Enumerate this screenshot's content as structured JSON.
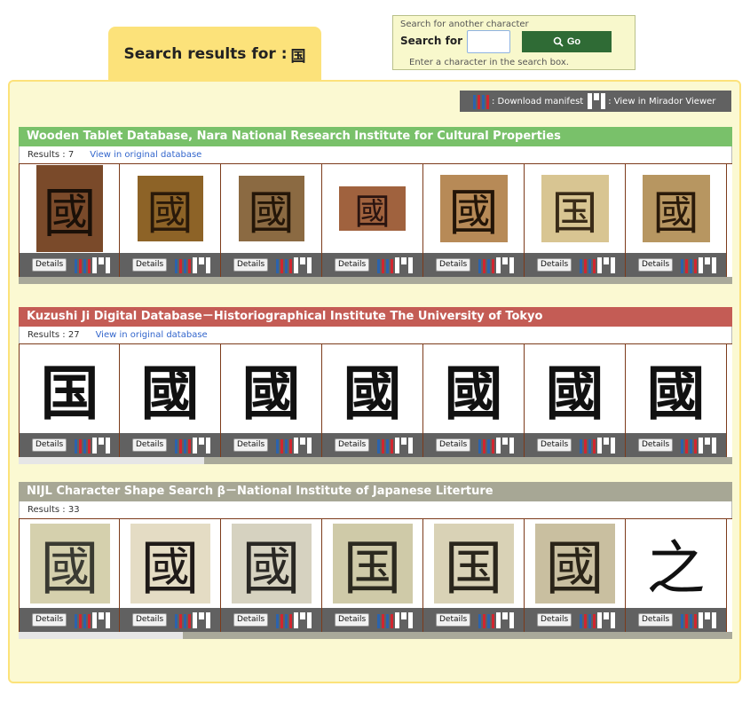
{
  "header": {
    "title_prefix": "Search results for :",
    "query_char": "国"
  },
  "search": {
    "caption": "Search for another character",
    "label": "Search for",
    "value": "",
    "go_label": "Go",
    "hint": "Enter a character in the search box."
  },
  "toolbar": {
    "download_label": ": Download manifest",
    "mirador_label": ": View in Mirador Viewer"
  },
  "icons": {
    "iiif_colors": [
      "#2b63ad",
      "#d1262f",
      "#2b63ad",
      "#d1262f"
    ]
  },
  "sections": [
    {
      "title": "Wooden Tablet Database, Nara National Research Institute for Cultural Properties",
      "header_color": "#79c16a",
      "results_label": "Results : 7",
      "link_label": "View in original database",
      "details_label": "Details",
      "scroll_fraction": 1.0,
      "items": [
        {
          "glyph": "國",
          "bg": "#7a4a2a",
          "fg": "#1a1008"
        },
        {
          "glyph": "國",
          "bg": "#8d6327",
          "fg": "#2a1a0a"
        },
        {
          "glyph": "國",
          "bg": "#8b6a42",
          "fg": "#241608"
        },
        {
          "glyph": "國",
          "bg": "#a0623e",
          "fg": "#2a1410"
        },
        {
          "glyph": "國",
          "bg": "#b78a57",
          "fg": "#231508"
        },
        {
          "glyph": "国",
          "bg": "#d8c592",
          "fg": "#3a2c18"
        },
        {
          "glyph": "國",
          "bg": "#b79661",
          "fg": "#2a1a0a"
        }
      ]
    },
    {
      "title": "Kuzushi Ji Digital Database－Historiographical Institute The University of Tokyo",
      "header_color": "#c45c55",
      "results_label": "Results : 27",
      "link_label": "View in original database",
      "details_label": "Details",
      "scroll_fraction": 0.26,
      "items": [
        {
          "glyph": "国",
          "bg": "#ffffff",
          "fg": "#111111"
        },
        {
          "glyph": "國",
          "bg": "#ffffff",
          "fg": "#111111"
        },
        {
          "glyph": "國",
          "bg": "#ffffff",
          "fg": "#111111"
        },
        {
          "glyph": "國",
          "bg": "#ffffff",
          "fg": "#111111"
        },
        {
          "glyph": "國",
          "bg": "#ffffff",
          "fg": "#111111"
        },
        {
          "glyph": "國",
          "bg": "#ffffff",
          "fg": "#111111"
        },
        {
          "glyph": "國",
          "bg": "#ffffff",
          "fg": "#111111"
        }
      ]
    },
    {
      "title": "NIJL Character Shape Search β－National Institute of Japanese Literture",
      "header_color": "#a7a795",
      "results_label": "Results : 33",
      "link_label": "",
      "details_label": "Details",
      "scroll_fraction": 0.23,
      "items": [
        {
          "glyph": "國",
          "bg": "#d5d0ad",
          "fg": "#3a3a32"
        },
        {
          "glyph": "國",
          "bg": "#e4dcc4",
          "fg": "#1f1a18"
        },
        {
          "glyph": "國",
          "bg": "#d6d2c0",
          "fg": "#2a2824"
        },
        {
          "glyph": "国",
          "bg": "#cfcaa8",
          "fg": "#2c2a20"
        },
        {
          "glyph": "国",
          "bg": "#d9d2b6",
          "fg": "#2a261c"
        },
        {
          "glyph": "國",
          "bg": "#c9bfa0",
          "fg": "#2a2418"
        },
        {
          "glyph": "之",
          "bg": "#ffffff",
          "fg": "#111111"
        }
      ]
    }
  ]
}
